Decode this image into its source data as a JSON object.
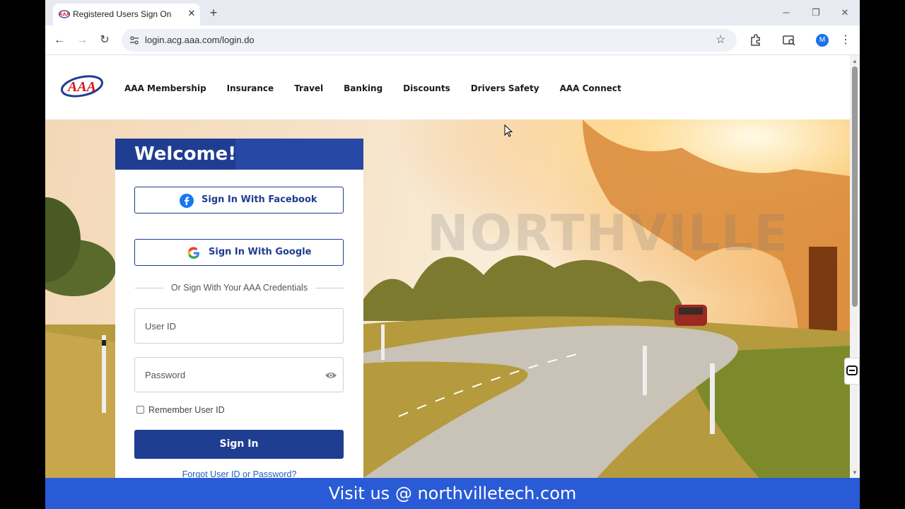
{
  "browser": {
    "tab_title": "Registered Users Sign On",
    "url": "login.acg.aaa.com/login.do",
    "profile_initial": "M"
  },
  "site": {
    "logo_text": "AAA",
    "nav": [
      "AAA Membership",
      "Insurance",
      "Travel",
      "Banking",
      "Discounts",
      "Drivers Safety",
      "AAA Connect"
    ]
  },
  "login": {
    "welcome": "Welcome!",
    "facebook_label": "Sign In With Facebook",
    "google_label": "Sign In With Google",
    "divider_text": "Or Sign With Your AAA Credentials",
    "user_id_placeholder": "User ID",
    "password_placeholder": "Password",
    "remember_label": "Remember User ID",
    "signin_label": "Sign In",
    "forgot_label": "Forgot User ID or Password?"
  },
  "watermark": {
    "text": "NORTHVILLE"
  },
  "banner": {
    "text": "Visit us @ northvilletech.com"
  },
  "colors": {
    "brand_blue": "#1f3d91",
    "banner_blue": "#2a5bd7",
    "aaa_red": "#d6131c"
  }
}
